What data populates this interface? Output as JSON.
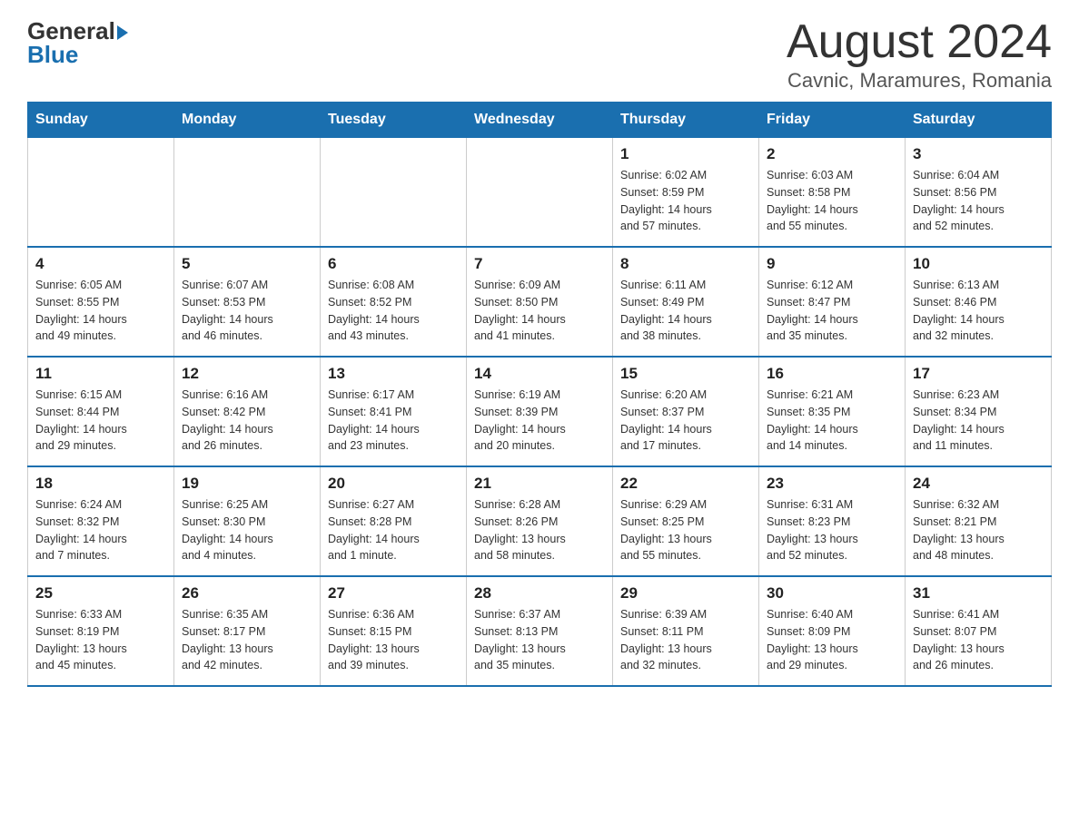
{
  "header": {
    "logo_general": "General",
    "logo_blue": "Blue",
    "month_year": "August 2024",
    "location": "Cavnic, Maramures, Romania"
  },
  "weekdays": [
    "Sunday",
    "Monday",
    "Tuesday",
    "Wednesday",
    "Thursday",
    "Friday",
    "Saturday"
  ],
  "weeks": [
    [
      {
        "day": "",
        "info": ""
      },
      {
        "day": "",
        "info": ""
      },
      {
        "day": "",
        "info": ""
      },
      {
        "day": "",
        "info": ""
      },
      {
        "day": "1",
        "info": "Sunrise: 6:02 AM\nSunset: 8:59 PM\nDaylight: 14 hours\nand 57 minutes."
      },
      {
        "day": "2",
        "info": "Sunrise: 6:03 AM\nSunset: 8:58 PM\nDaylight: 14 hours\nand 55 minutes."
      },
      {
        "day": "3",
        "info": "Sunrise: 6:04 AM\nSunset: 8:56 PM\nDaylight: 14 hours\nand 52 minutes."
      }
    ],
    [
      {
        "day": "4",
        "info": "Sunrise: 6:05 AM\nSunset: 8:55 PM\nDaylight: 14 hours\nand 49 minutes."
      },
      {
        "day": "5",
        "info": "Sunrise: 6:07 AM\nSunset: 8:53 PM\nDaylight: 14 hours\nand 46 minutes."
      },
      {
        "day": "6",
        "info": "Sunrise: 6:08 AM\nSunset: 8:52 PM\nDaylight: 14 hours\nand 43 minutes."
      },
      {
        "day": "7",
        "info": "Sunrise: 6:09 AM\nSunset: 8:50 PM\nDaylight: 14 hours\nand 41 minutes."
      },
      {
        "day": "8",
        "info": "Sunrise: 6:11 AM\nSunset: 8:49 PM\nDaylight: 14 hours\nand 38 minutes."
      },
      {
        "day": "9",
        "info": "Sunrise: 6:12 AM\nSunset: 8:47 PM\nDaylight: 14 hours\nand 35 minutes."
      },
      {
        "day": "10",
        "info": "Sunrise: 6:13 AM\nSunset: 8:46 PM\nDaylight: 14 hours\nand 32 minutes."
      }
    ],
    [
      {
        "day": "11",
        "info": "Sunrise: 6:15 AM\nSunset: 8:44 PM\nDaylight: 14 hours\nand 29 minutes."
      },
      {
        "day": "12",
        "info": "Sunrise: 6:16 AM\nSunset: 8:42 PM\nDaylight: 14 hours\nand 26 minutes."
      },
      {
        "day": "13",
        "info": "Sunrise: 6:17 AM\nSunset: 8:41 PM\nDaylight: 14 hours\nand 23 minutes."
      },
      {
        "day": "14",
        "info": "Sunrise: 6:19 AM\nSunset: 8:39 PM\nDaylight: 14 hours\nand 20 minutes."
      },
      {
        "day": "15",
        "info": "Sunrise: 6:20 AM\nSunset: 8:37 PM\nDaylight: 14 hours\nand 17 minutes."
      },
      {
        "day": "16",
        "info": "Sunrise: 6:21 AM\nSunset: 8:35 PM\nDaylight: 14 hours\nand 14 minutes."
      },
      {
        "day": "17",
        "info": "Sunrise: 6:23 AM\nSunset: 8:34 PM\nDaylight: 14 hours\nand 11 minutes."
      }
    ],
    [
      {
        "day": "18",
        "info": "Sunrise: 6:24 AM\nSunset: 8:32 PM\nDaylight: 14 hours\nand 7 minutes."
      },
      {
        "day": "19",
        "info": "Sunrise: 6:25 AM\nSunset: 8:30 PM\nDaylight: 14 hours\nand 4 minutes."
      },
      {
        "day": "20",
        "info": "Sunrise: 6:27 AM\nSunset: 8:28 PM\nDaylight: 14 hours\nand 1 minute."
      },
      {
        "day": "21",
        "info": "Sunrise: 6:28 AM\nSunset: 8:26 PM\nDaylight: 13 hours\nand 58 minutes."
      },
      {
        "day": "22",
        "info": "Sunrise: 6:29 AM\nSunset: 8:25 PM\nDaylight: 13 hours\nand 55 minutes."
      },
      {
        "day": "23",
        "info": "Sunrise: 6:31 AM\nSunset: 8:23 PM\nDaylight: 13 hours\nand 52 minutes."
      },
      {
        "day": "24",
        "info": "Sunrise: 6:32 AM\nSunset: 8:21 PM\nDaylight: 13 hours\nand 48 minutes."
      }
    ],
    [
      {
        "day": "25",
        "info": "Sunrise: 6:33 AM\nSunset: 8:19 PM\nDaylight: 13 hours\nand 45 minutes."
      },
      {
        "day": "26",
        "info": "Sunrise: 6:35 AM\nSunset: 8:17 PM\nDaylight: 13 hours\nand 42 minutes."
      },
      {
        "day": "27",
        "info": "Sunrise: 6:36 AM\nSunset: 8:15 PM\nDaylight: 13 hours\nand 39 minutes."
      },
      {
        "day": "28",
        "info": "Sunrise: 6:37 AM\nSunset: 8:13 PM\nDaylight: 13 hours\nand 35 minutes."
      },
      {
        "day": "29",
        "info": "Sunrise: 6:39 AM\nSunset: 8:11 PM\nDaylight: 13 hours\nand 32 minutes."
      },
      {
        "day": "30",
        "info": "Sunrise: 6:40 AM\nSunset: 8:09 PM\nDaylight: 13 hours\nand 29 minutes."
      },
      {
        "day": "31",
        "info": "Sunrise: 6:41 AM\nSunset: 8:07 PM\nDaylight: 13 hours\nand 26 minutes."
      }
    ]
  ]
}
